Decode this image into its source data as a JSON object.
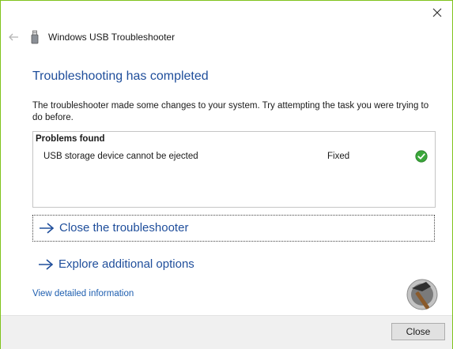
{
  "window": {
    "close_icon": "close-icon",
    "back_icon": "back-arrow-icon",
    "app_icon": "usb-drive-icon",
    "title": "Windows USB Troubleshooter"
  },
  "content": {
    "heading": "Troubleshooting has completed",
    "description": "The troubleshooter made some changes to your system. Try attempting the task you were trying to do before.",
    "problems": {
      "header": "Problems found",
      "items": [
        {
          "name": "USB storage device cannot be ejected",
          "status": "Fixed",
          "status_icon": "green-check-icon"
        }
      ]
    },
    "options": [
      {
        "label": "Close the troubleshooter",
        "icon": "arrow-right-icon"
      },
      {
        "label": "Explore additional options",
        "icon": "arrow-right-icon"
      }
    ],
    "detail_link": "View detailed information"
  },
  "footer": {
    "close_label": "Close"
  },
  "colors": {
    "accent": "#1f4e9b",
    "link": "#1f5fb0",
    "frame": "#7fc31c",
    "success": "#3aa73a"
  }
}
